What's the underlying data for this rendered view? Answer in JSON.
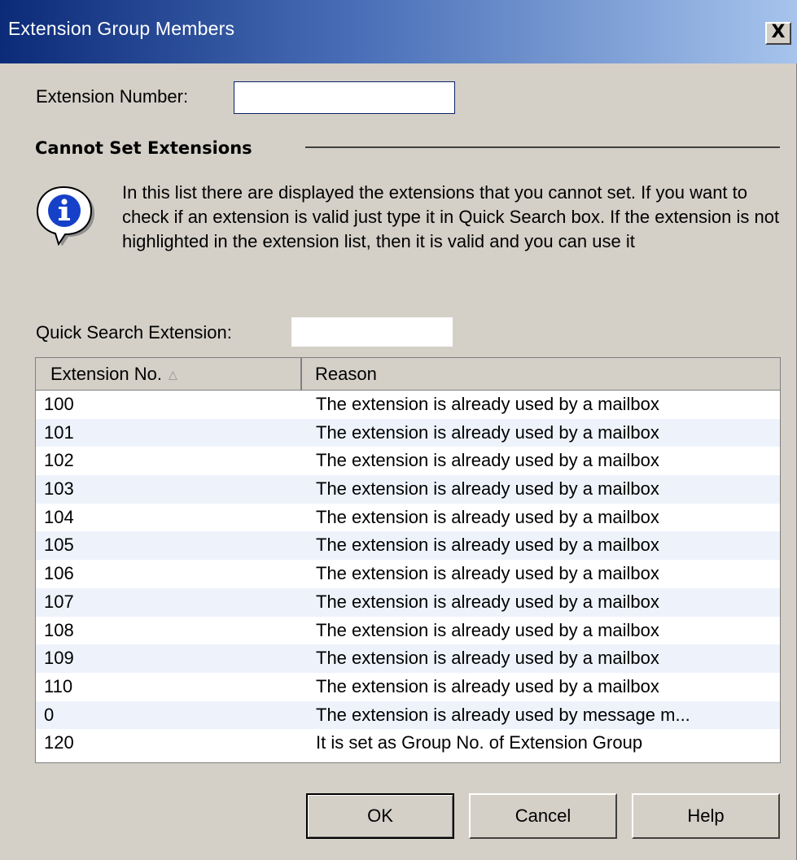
{
  "window": {
    "title": "Extension Group Members",
    "close_label": "X"
  },
  "form": {
    "extension_number_label": "Extension Number:",
    "extension_number_value": "",
    "quick_search_label": "Quick Search Extension:",
    "quick_search_value": ""
  },
  "section": {
    "title": "Cannot Set Extensions",
    "info_text": "In this list there are displayed the extensions that you cannot set. If you want to check if an extension is valid just type it in Quick Search box. If the extension is not highlighted in the extension list, then it is valid and you can use it",
    "info_icon": "info-icon"
  },
  "list": {
    "columns": [
      "Extension No.",
      "Reason"
    ],
    "sort_indicator": "△",
    "rows": [
      {
        "ext": "100",
        "reason": "The extension is already used by a mailbox"
      },
      {
        "ext": "101",
        "reason": "The extension is already used by a mailbox"
      },
      {
        "ext": "102",
        "reason": "The extension is already used by a mailbox"
      },
      {
        "ext": "103",
        "reason": "The extension is already used by a mailbox"
      },
      {
        "ext": "104",
        "reason": "The extension is already used by a mailbox"
      },
      {
        "ext": "105",
        "reason": "The extension is already used by a mailbox"
      },
      {
        "ext": "106",
        "reason": "The extension is already used by a mailbox"
      },
      {
        "ext": "107",
        "reason": "The extension is already used by a mailbox"
      },
      {
        "ext": "108",
        "reason": "The extension is already used by a mailbox"
      },
      {
        "ext": "109",
        "reason": "The extension is already used by a mailbox"
      },
      {
        "ext": "110",
        "reason": "The extension is already used by a mailbox"
      },
      {
        "ext": "0",
        "reason": "The extension is already used by message m..."
      },
      {
        "ext": "120",
        "reason": "It is set as Group No. of Extension Group"
      }
    ]
  },
  "buttons": {
    "ok": "OK",
    "cancel": "Cancel",
    "help": "Help"
  },
  "colors": {
    "dialog_bg": "#d4d0c8",
    "title_start": "#0b2a78",
    "title_end": "#a6c4ec",
    "alt_row": "#eef3fb"
  }
}
